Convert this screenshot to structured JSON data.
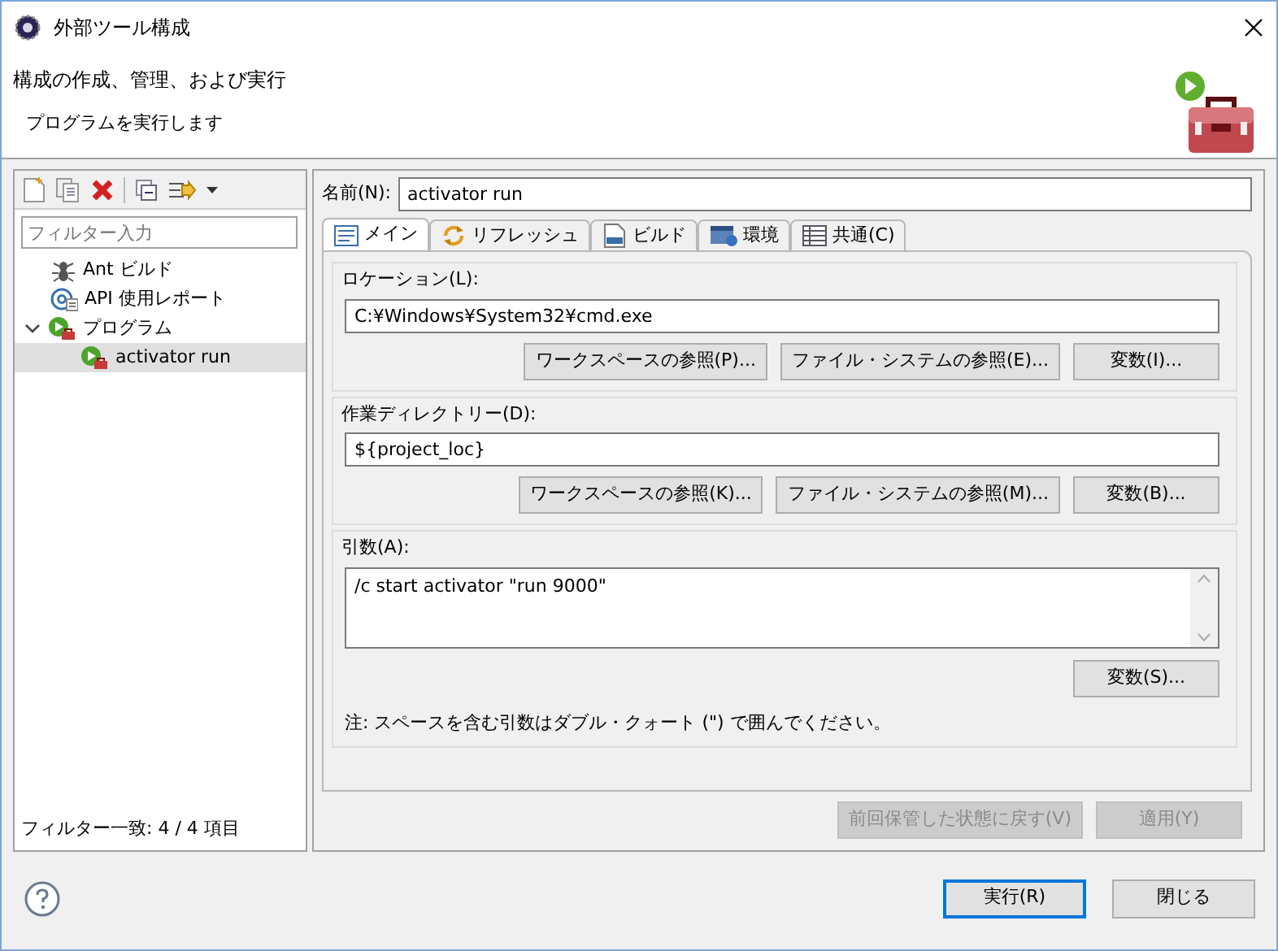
{
  "window": {
    "title": "外部ツール構成"
  },
  "header": {
    "title": "構成の作成、管理、および実行",
    "message": "プログラムを実行します"
  },
  "sidebar": {
    "filter": {
      "placeholder": "フィルター入力"
    },
    "tree": [
      {
        "label": "Ant ビルド",
        "kind": "ant",
        "selected": false
      },
      {
        "label": "API 使用レポート",
        "kind": "api",
        "selected": false
      },
      {
        "label": "プログラム",
        "kind": "program",
        "selected": false,
        "expanded": true,
        "children": [
          {
            "label": "activator run",
            "kind": "program",
            "selected": true
          }
        ]
      }
    ],
    "status": "フィルター一致: 4 / 4 項目"
  },
  "name_field": {
    "label": "名前(N):",
    "value": "activator run"
  },
  "tabs": [
    {
      "label": "メイン",
      "kind": "main",
      "selected": true
    },
    {
      "label": "リフレッシュ",
      "kind": "refresh",
      "selected": false
    },
    {
      "label": "ビルド",
      "kind": "build",
      "selected": false
    },
    {
      "label": "環境",
      "kind": "env",
      "selected": false
    },
    {
      "label": "共通(C)",
      "kind": "common",
      "selected": false
    }
  ],
  "groups": [
    {
      "label": "ロケーション(L):",
      "kind": "line",
      "value": "C:¥Windows¥System32¥cmd.exe",
      "buttons": [
        "ワークスペースの参照(P)...",
        "ファイル・システムの参照(E)...",
        "変数(I)..."
      ]
    },
    {
      "label": "作業ディレクトリー(D):",
      "kind": "line",
      "value": "${project_loc}",
      "buttons": [
        "ワークスペースの参照(K)...",
        "ファイル・システムの参照(M)...",
        "変数(B)..."
      ]
    },
    {
      "label": "引数(A):",
      "kind": "area",
      "value": "/c start activator \"run 9000\"",
      "buttons": [
        "変数(S)..."
      ],
      "note": "注: スペースを含む引数はダブル・クォート (\") で囲んでください。"
    }
  ],
  "panel_buttons": [
    {
      "label": "前回保管した状態に戻す(V)",
      "disabled": true
    },
    {
      "label": "適用(Y)",
      "disabled": true
    }
  ],
  "dialog_buttons": [
    {
      "label": "実行(R)",
      "default": true
    },
    {
      "label": "閉じる",
      "default": false
    }
  ]
}
